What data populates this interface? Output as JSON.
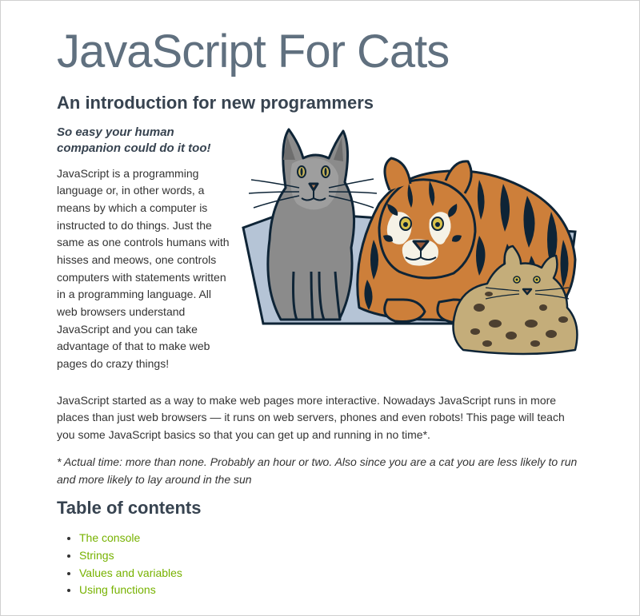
{
  "title": "JavaScript For Cats",
  "subtitle": "An introduction for new programmers",
  "tagline": "So easy your human companion could do it too!",
  "para1": "JavaScript is a programming language or, in other words, a means by which a computer is instructed to do things. Just the same as one controls humans with hisses and meows, one controls computers with statements written in a programming language. All web browsers understand JavaScript and you can take advantage of that to make web pages do crazy things!",
  "para2": "JavaScript started as a way to make web pages more interactive. Nowadays JavaScript runs in more places than just web browsers — it runs on web servers, phones and even robots! This page will teach you some JavaScript basics so that you can get up and running in no time*.",
  "footnote": "* Actual time: more than none. Probably an hour or two. Also since you are a cat you are less likely to run and more likely to lay around in the sun",
  "toc_heading": "Table of contents",
  "toc": {
    "items": [
      {
        "label": "The console"
      },
      {
        "label": "Strings"
      },
      {
        "label": "Values and variables"
      },
      {
        "label": "Using functions"
      }
    ]
  }
}
